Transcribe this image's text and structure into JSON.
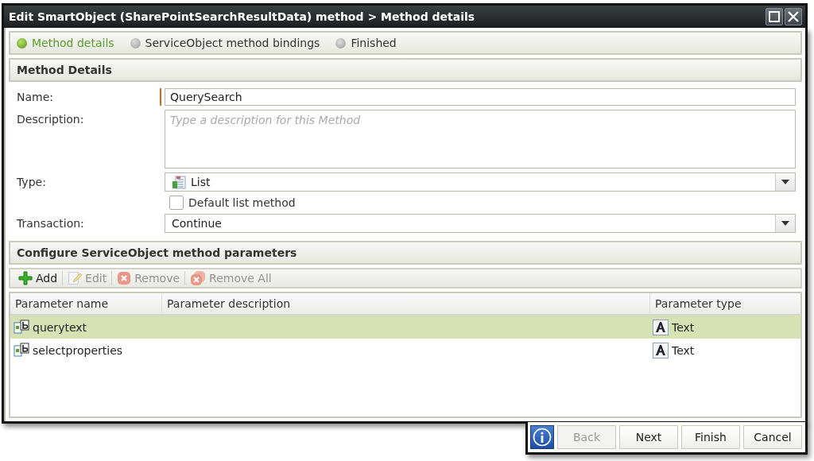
{
  "window": {
    "title": "Edit SmartObject (SharePointSearchResultData) method > Method details"
  },
  "steps": [
    {
      "label": "Method details",
      "selected": true
    },
    {
      "label": "ServiceObject method bindings",
      "selected": false
    },
    {
      "label": "Finished",
      "selected": false
    }
  ],
  "method_details": {
    "title": "Method Details",
    "name": {
      "label": "Name:",
      "value": "QuerySearch"
    },
    "description": {
      "label": "Description:",
      "placeholder": "Type a description for this Method"
    },
    "type": {
      "label": "Type:",
      "value": "List"
    },
    "default_list_method": {
      "label": "Default list method",
      "checked": false
    },
    "transaction": {
      "label": "Transaction:",
      "value": "Continue"
    }
  },
  "parameters": {
    "title": "Configure ServiceObject method parameters",
    "toolbar": [
      {
        "label": "Add",
        "kind": "add",
        "disabled": false
      },
      {
        "label": "Edit",
        "kind": "edit",
        "disabled": true
      },
      {
        "label": "Remove",
        "kind": "remove",
        "disabled": true
      },
      {
        "label": "Remove All",
        "kind": "remove_all",
        "disabled": true
      }
    ],
    "columns": [
      "Parameter name",
      "Parameter description",
      "Parameter type"
    ],
    "rows": [
      {
        "name": "querytext",
        "type": "Text",
        "selected": true
      },
      {
        "name": "selectproperties",
        "type": "Text",
        "selected": false
      }
    ]
  },
  "buttons": [
    {
      "label": "Back",
      "disabled": true
    },
    {
      "label": "Next",
      "disabled": false
    },
    {
      "label": "Finish",
      "disabled": false
    },
    {
      "label": "Cancel",
      "disabled": false
    }
  ]
}
